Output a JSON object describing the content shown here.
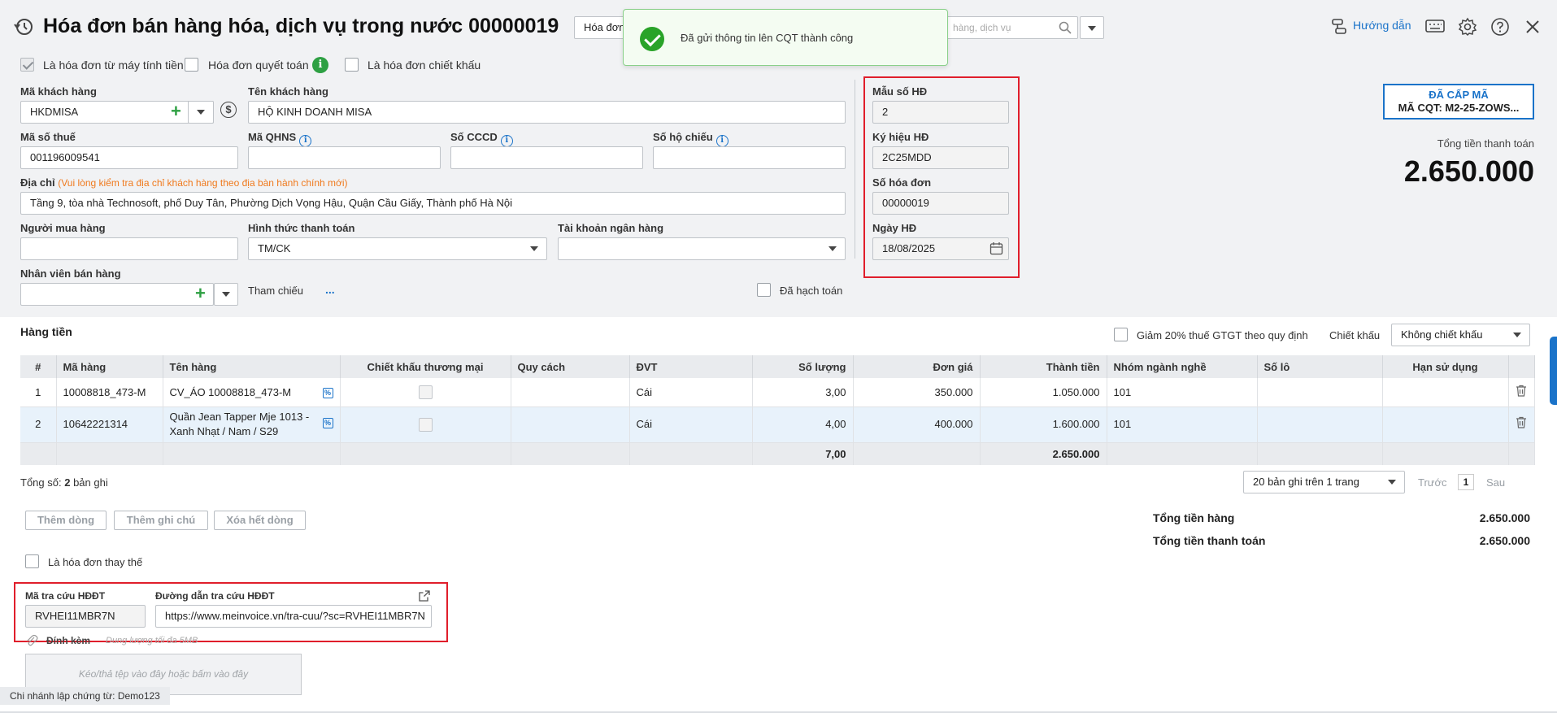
{
  "header": {
    "title": "Hóa đơn bán hàng hóa, dịch vụ trong nước 00000019",
    "invoice_type_select": "Hóa đơn",
    "search_placeholder": "hàng, dịch vụ",
    "help_label": "Hướng dẫn"
  },
  "toast": {
    "message": "Đã gửi thông tin lên CQT thành công"
  },
  "options": {
    "from_cash_register": "Là hóa đơn từ máy tính tiền",
    "settlement": "Hóa đơn quyết toán",
    "discount": "Là hóa đơn chiết khấu"
  },
  "customer": {
    "code_label": "Mã khách hàng",
    "code": "HKDMISA",
    "name_label": "Tên khách hàng",
    "name": "HỘ KINH DOANH MISA",
    "tax_label": "Mã số thuế",
    "tax": "001196009541",
    "qhns_label": "Mã QHNS",
    "cccd_label": "Số CCCD",
    "passport_label": "Số hộ chiếu",
    "address_label": "Địa chỉ",
    "address_note": "(Vui lòng kiểm tra địa chỉ khách hàng theo địa bàn hành chính mới)",
    "address": "Tầng 9, tòa nhà Technosoft, phố Duy Tân, Phường Dịch Vọng Hậu, Quận Cầu Giấy, Thành phố Hà Nội",
    "buyer_label": "Người mua hàng",
    "payment_label": "Hình thức thanh toán",
    "payment": "TM/CK",
    "bank_label": "Tài khoản ngân hàng",
    "seller_label": "Nhân viên bán hàng",
    "reference_label": "Tham chiếu",
    "reference_more": "...",
    "accounted_label": "Đã hạch toán"
  },
  "invoice": {
    "template_label": "Mẫu số HĐ",
    "template": "2",
    "symbol_label": "Ký hiệu HĐ",
    "symbol": "2C25MDD",
    "number_label": "Số hóa đơn",
    "number": "00000019",
    "date_label": "Ngày HĐ",
    "date": "18/08/2025"
  },
  "status": {
    "badge_title": "ĐÃ CẤP MÃ",
    "badge_code": "MÃ CQT: M2-25-ZOWS...",
    "total_label": "Tổng tiền thanh toán",
    "total": "2.650.000"
  },
  "items": {
    "section_title": "Hàng tiền",
    "vat_reduce_label": "Giảm 20% thuế GTGT theo quy định",
    "discount_label": "Chiết khấu",
    "discount_value": "Không chiết khấu",
    "columns": [
      "#",
      "Mã hàng",
      "Tên hàng",
      "Chiết khấu thương mại",
      "Quy cách",
      "ĐVT",
      "Số lượng",
      "Đơn giá",
      "Thành tiền",
      "Nhóm ngành nghề",
      "Số lô",
      "Hạn sử dụng"
    ],
    "rows": [
      {
        "no": "1",
        "code": "10008818_473-M",
        "name": "CV_ÁO 10008818_473-M",
        "unit": "Cái",
        "qty": "3,00",
        "price": "350.000",
        "amount": "1.050.000",
        "group": "101"
      },
      {
        "no": "2",
        "code": "10642221314",
        "name": "Quần Jean Tapper Mje 1013 - Xanh Nhạt / Nam / S29",
        "unit": "Cái",
        "qty": "4,00",
        "price": "400.000",
        "amount": "1.600.000",
        "group": "101"
      }
    ],
    "total_qty": "7,00",
    "total_amount": "2.650.000"
  },
  "pagination": {
    "count_prefix": "Tổng số:",
    "count": "2",
    "count_suffix": "bản ghi",
    "page_size": "20 bản ghi trên 1 trang",
    "prev": "Trước",
    "page": "1",
    "next": "Sau"
  },
  "actions": {
    "add_row": "Thêm dòng",
    "add_note": "Thêm ghi chú",
    "clear_rows": "Xóa hết dòng"
  },
  "summary": {
    "goods_label": "Tổng tiền hàng",
    "goods": "2.650.000",
    "pay_label": "Tổng tiền thanh toán",
    "pay": "2.650.000"
  },
  "replacement_label": "Là hóa đơn thay thế",
  "lookup": {
    "code_label": "Mã tra cứu HĐĐT",
    "code": "RVHEI11MBR7N",
    "url_label": "Đường dẫn tra cứu HĐĐT",
    "url": "https://www.meinvoice.vn/tra-cuu/?sc=RVHEI11MBR7N"
  },
  "attachment": {
    "label": "Đính kèm",
    "hint": "Dung lượng tối đa 5MB",
    "drop": "Kéo/thả tệp vào đây hoặc bấm vào đây"
  },
  "footer": {
    "branch": "Chi nhánh lập chứng từ: Demo123"
  }
}
